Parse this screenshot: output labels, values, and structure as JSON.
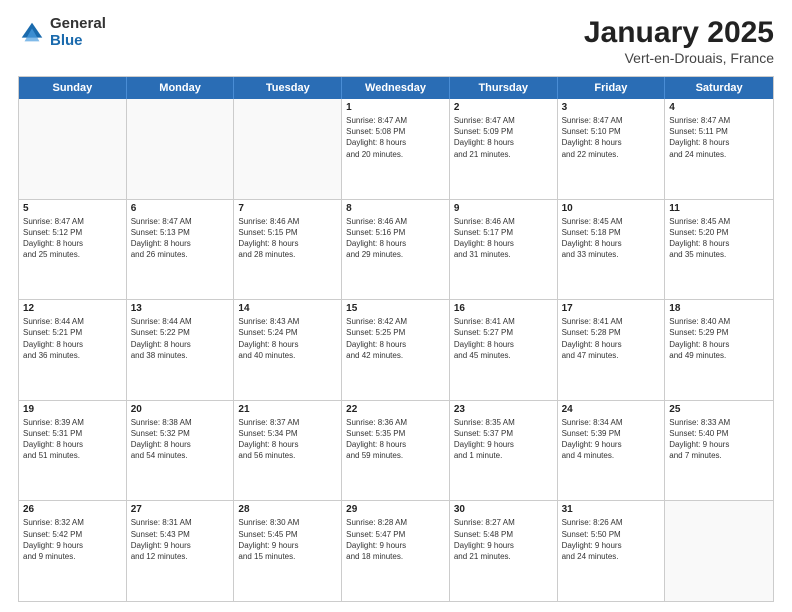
{
  "logo": {
    "general": "General",
    "blue": "Blue"
  },
  "title": "January 2025",
  "subtitle": "Vert-en-Drouais, France",
  "headers": [
    "Sunday",
    "Monday",
    "Tuesday",
    "Wednesday",
    "Thursday",
    "Friday",
    "Saturday"
  ],
  "weeks": [
    [
      {
        "day": "",
        "info": ""
      },
      {
        "day": "",
        "info": ""
      },
      {
        "day": "",
        "info": ""
      },
      {
        "day": "1",
        "info": "Sunrise: 8:47 AM\nSunset: 5:08 PM\nDaylight: 8 hours\nand 20 minutes."
      },
      {
        "day": "2",
        "info": "Sunrise: 8:47 AM\nSunset: 5:09 PM\nDaylight: 8 hours\nand 21 minutes."
      },
      {
        "day": "3",
        "info": "Sunrise: 8:47 AM\nSunset: 5:10 PM\nDaylight: 8 hours\nand 22 minutes."
      },
      {
        "day": "4",
        "info": "Sunrise: 8:47 AM\nSunset: 5:11 PM\nDaylight: 8 hours\nand 24 minutes."
      }
    ],
    [
      {
        "day": "5",
        "info": "Sunrise: 8:47 AM\nSunset: 5:12 PM\nDaylight: 8 hours\nand 25 minutes."
      },
      {
        "day": "6",
        "info": "Sunrise: 8:47 AM\nSunset: 5:13 PM\nDaylight: 8 hours\nand 26 minutes."
      },
      {
        "day": "7",
        "info": "Sunrise: 8:46 AM\nSunset: 5:15 PM\nDaylight: 8 hours\nand 28 minutes."
      },
      {
        "day": "8",
        "info": "Sunrise: 8:46 AM\nSunset: 5:16 PM\nDaylight: 8 hours\nand 29 minutes."
      },
      {
        "day": "9",
        "info": "Sunrise: 8:46 AM\nSunset: 5:17 PM\nDaylight: 8 hours\nand 31 minutes."
      },
      {
        "day": "10",
        "info": "Sunrise: 8:45 AM\nSunset: 5:18 PM\nDaylight: 8 hours\nand 33 minutes."
      },
      {
        "day": "11",
        "info": "Sunrise: 8:45 AM\nSunset: 5:20 PM\nDaylight: 8 hours\nand 35 minutes."
      }
    ],
    [
      {
        "day": "12",
        "info": "Sunrise: 8:44 AM\nSunset: 5:21 PM\nDaylight: 8 hours\nand 36 minutes."
      },
      {
        "day": "13",
        "info": "Sunrise: 8:44 AM\nSunset: 5:22 PM\nDaylight: 8 hours\nand 38 minutes."
      },
      {
        "day": "14",
        "info": "Sunrise: 8:43 AM\nSunset: 5:24 PM\nDaylight: 8 hours\nand 40 minutes."
      },
      {
        "day": "15",
        "info": "Sunrise: 8:42 AM\nSunset: 5:25 PM\nDaylight: 8 hours\nand 42 minutes."
      },
      {
        "day": "16",
        "info": "Sunrise: 8:41 AM\nSunset: 5:27 PM\nDaylight: 8 hours\nand 45 minutes."
      },
      {
        "day": "17",
        "info": "Sunrise: 8:41 AM\nSunset: 5:28 PM\nDaylight: 8 hours\nand 47 minutes."
      },
      {
        "day": "18",
        "info": "Sunrise: 8:40 AM\nSunset: 5:29 PM\nDaylight: 8 hours\nand 49 minutes."
      }
    ],
    [
      {
        "day": "19",
        "info": "Sunrise: 8:39 AM\nSunset: 5:31 PM\nDaylight: 8 hours\nand 51 minutes."
      },
      {
        "day": "20",
        "info": "Sunrise: 8:38 AM\nSunset: 5:32 PM\nDaylight: 8 hours\nand 54 minutes."
      },
      {
        "day": "21",
        "info": "Sunrise: 8:37 AM\nSunset: 5:34 PM\nDaylight: 8 hours\nand 56 minutes."
      },
      {
        "day": "22",
        "info": "Sunrise: 8:36 AM\nSunset: 5:35 PM\nDaylight: 8 hours\nand 59 minutes."
      },
      {
        "day": "23",
        "info": "Sunrise: 8:35 AM\nSunset: 5:37 PM\nDaylight: 9 hours\nand 1 minute."
      },
      {
        "day": "24",
        "info": "Sunrise: 8:34 AM\nSunset: 5:39 PM\nDaylight: 9 hours\nand 4 minutes."
      },
      {
        "day": "25",
        "info": "Sunrise: 8:33 AM\nSunset: 5:40 PM\nDaylight: 9 hours\nand 7 minutes."
      }
    ],
    [
      {
        "day": "26",
        "info": "Sunrise: 8:32 AM\nSunset: 5:42 PM\nDaylight: 9 hours\nand 9 minutes."
      },
      {
        "day": "27",
        "info": "Sunrise: 8:31 AM\nSunset: 5:43 PM\nDaylight: 9 hours\nand 12 minutes."
      },
      {
        "day": "28",
        "info": "Sunrise: 8:30 AM\nSunset: 5:45 PM\nDaylight: 9 hours\nand 15 minutes."
      },
      {
        "day": "29",
        "info": "Sunrise: 8:28 AM\nSunset: 5:47 PM\nDaylight: 9 hours\nand 18 minutes."
      },
      {
        "day": "30",
        "info": "Sunrise: 8:27 AM\nSunset: 5:48 PM\nDaylight: 9 hours\nand 21 minutes."
      },
      {
        "day": "31",
        "info": "Sunrise: 8:26 AM\nSunset: 5:50 PM\nDaylight: 9 hours\nand 24 minutes."
      },
      {
        "day": "",
        "info": ""
      }
    ]
  ]
}
